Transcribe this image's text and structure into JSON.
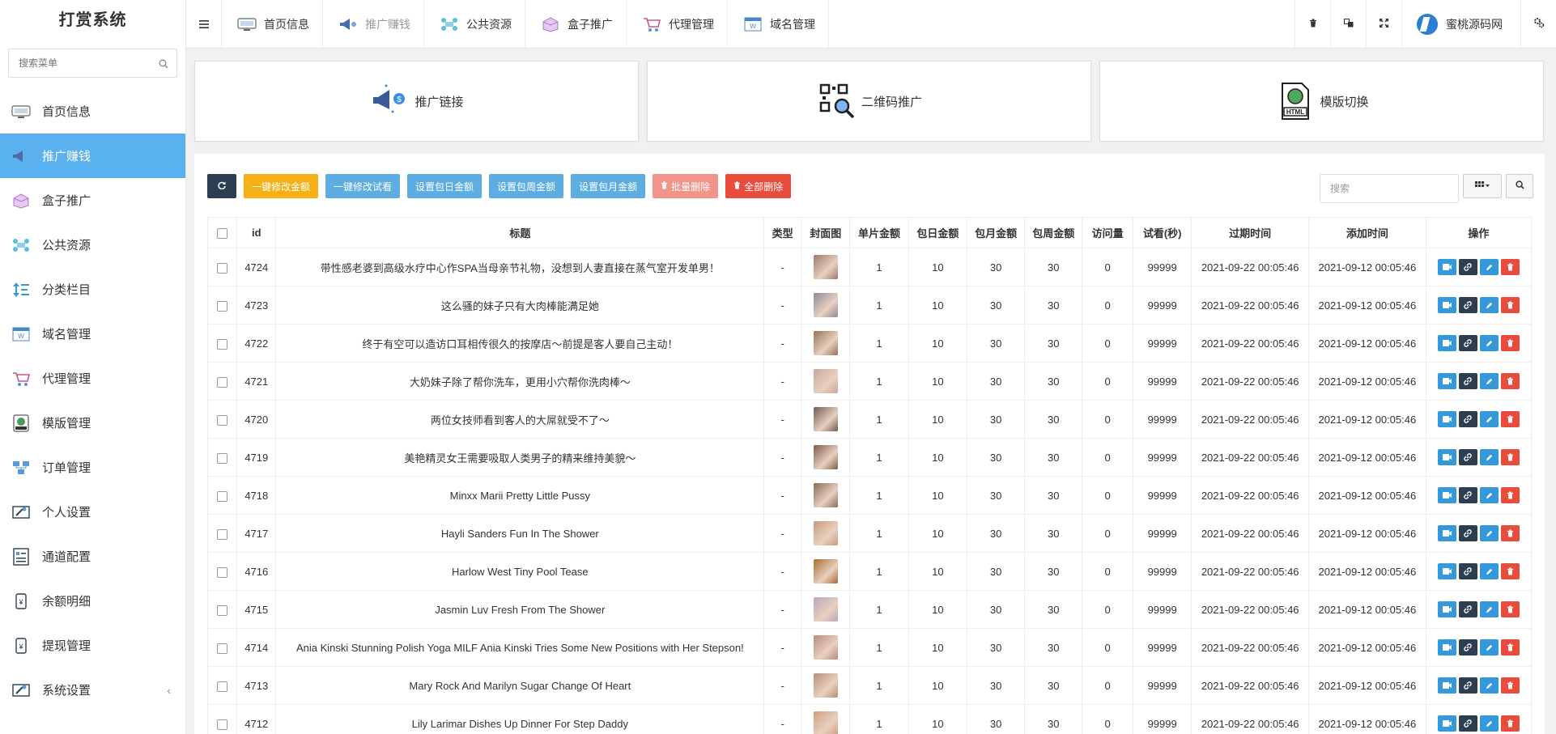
{
  "sidebar": {
    "logo": "打赏系统",
    "search_placeholder": "搜索菜单",
    "items": [
      {
        "label": "首页信息",
        "icon": "monitor-icon"
      },
      {
        "label": "推广赚钱",
        "icon": "megaphone-icon",
        "active": true
      },
      {
        "label": "盒子推广",
        "icon": "box-icon"
      },
      {
        "label": "公共资源",
        "icon": "cloud-network-icon"
      },
      {
        "label": "分类栏目",
        "icon": "sort-icon"
      },
      {
        "label": "域名管理",
        "icon": "domain-window-icon"
      },
      {
        "label": "代理管理",
        "icon": "cart-icon"
      },
      {
        "label": "模版管理",
        "icon": "html-globe-icon"
      },
      {
        "label": "订单管理",
        "icon": "network-order-icon"
      },
      {
        "label": "个人设置",
        "icon": "wrench-card-icon"
      },
      {
        "label": "通道配置",
        "icon": "form-icon"
      },
      {
        "label": "余额明细",
        "icon": "phone-balance-icon"
      },
      {
        "label": "提现管理",
        "icon": "phone-withdraw-icon"
      },
      {
        "label": "系统设置",
        "icon": "settings-card-icon",
        "arrow": "‹"
      }
    ]
  },
  "topbar": {
    "tabs": [
      {
        "label": "首页信息",
        "icon": "monitor-icon"
      },
      {
        "label": "推广赚钱",
        "icon": "megaphone-icon",
        "dim": true
      },
      {
        "label": "公共资源",
        "icon": "cloud-network-icon"
      },
      {
        "label": "盒子推广",
        "icon": "box-icon"
      },
      {
        "label": "代理管理",
        "icon": "cart-icon"
      },
      {
        "label": "域名管理",
        "icon": "domain-window-icon"
      }
    ],
    "user": "蜜桃源码网"
  },
  "cards": [
    {
      "label": "推广链接",
      "icon": "megaphone-coin-icon"
    },
    {
      "label": "二维码推广",
      "icon": "qr-search-icon"
    },
    {
      "label": "模版切换",
      "icon": "html-file-icon"
    }
  ],
  "toolbar": {
    "buttons": [
      "一键修改金额",
      "一键修改试看",
      "设置包日金额",
      "设置包周金额",
      "设置包月金额",
      "批量删除",
      "全部删除"
    ],
    "search_placeholder": "搜索"
  },
  "table": {
    "headers": [
      "id",
      "标题",
      "类型",
      "封面图",
      "单片金额",
      "包日金额",
      "包月金额",
      "包周金额",
      "访问量",
      "试看(秒)",
      "过期时间",
      "添加时间",
      "操作"
    ],
    "rows": [
      {
        "id": "4724",
        "title": "带性感老婆到高级水疗中心作SPA当母亲节礼物，没想到人妻直接在蒸气室开发单男！",
        "type": "-",
        "price": "1",
        "day": "10",
        "month": "30",
        "week": "30",
        "visits": "0",
        "trial": "99999",
        "expire": "2021-09-22 00:05:46",
        "added": "2021-09-12 00:05:46",
        "thumb": "#a0786a"
      },
      {
        "id": "4723",
        "title": "这么骚的妹子只有大肉棒能满足她",
        "type": "-",
        "price": "1",
        "day": "10",
        "month": "30",
        "week": "30",
        "visits": "0",
        "trial": "99999",
        "expire": "2021-09-22 00:05:46",
        "added": "2021-09-12 00:05:46",
        "thumb": "#8f8a98"
      },
      {
        "id": "4722",
        "title": "终于有空可以造访口耳相传很久的按摩店～前提是客人要自己主动！",
        "type": "-",
        "price": "1",
        "day": "10",
        "month": "30",
        "week": "30",
        "visits": "0",
        "trial": "99999",
        "expire": "2021-09-22 00:05:46",
        "added": "2021-09-12 00:05:46",
        "thumb": "#9a7058"
      },
      {
        "id": "4721",
        "title": "大奶妹子除了帮你洗车，更用小穴帮你洗肉棒～",
        "type": "-",
        "price": "1",
        "day": "10",
        "month": "30",
        "week": "30",
        "visits": "0",
        "trial": "99999",
        "expire": "2021-09-22 00:05:46",
        "added": "2021-09-12 00:05:46",
        "thumb": "#c8a89a"
      },
      {
        "id": "4720",
        "title": "两位女技师看到客人的大屌就受不了～",
        "type": "-",
        "price": "1",
        "day": "10",
        "month": "30",
        "week": "30",
        "visits": "0",
        "trial": "99999",
        "expire": "2021-09-22 00:05:46",
        "added": "2021-09-12 00:05:46",
        "thumb": "#6e5a50"
      },
      {
        "id": "4719",
        "title": "美艳精灵女王需要吸取人类男子的精来维持美貌～",
        "type": "-",
        "price": "1",
        "day": "10",
        "month": "30",
        "week": "30",
        "visits": "0",
        "trial": "99999",
        "expire": "2021-09-22 00:05:46",
        "added": "2021-09-12 00:05:46",
        "thumb": "#7e5a48"
      },
      {
        "id": "4718",
        "title": "Minxx Marii Pretty Little Pussy",
        "type": "-",
        "price": "1",
        "day": "10",
        "month": "30",
        "week": "30",
        "visits": "0",
        "trial": "99999",
        "expire": "2021-09-22 00:05:46",
        "added": "2021-09-12 00:05:46",
        "thumb": "#8a6a58"
      },
      {
        "id": "4717",
        "title": "Hayli Sanders Fun In The Shower",
        "type": "-",
        "price": "1",
        "day": "10",
        "month": "30",
        "week": "30",
        "visits": "0",
        "trial": "99999",
        "expire": "2021-09-22 00:05:46",
        "added": "2021-09-12 00:05:46",
        "thumb": "#c99a7a"
      },
      {
        "id": "4716",
        "title": "Harlow West Tiny Pool Tease",
        "type": "-",
        "price": "1",
        "day": "10",
        "month": "30",
        "week": "30",
        "visits": "0",
        "trial": "99999",
        "expire": "2021-09-22 00:05:46",
        "added": "2021-09-12 00:05:46",
        "thumb": "#a86a30"
      },
      {
        "id": "4715",
        "title": "Jasmin Luv Fresh From The Shower",
        "type": "-",
        "price": "1",
        "day": "10",
        "month": "30",
        "week": "30",
        "visits": "0",
        "trial": "99999",
        "expire": "2021-09-22 00:05:46",
        "added": "2021-09-12 00:05:46",
        "thumb": "#b8a8b8"
      },
      {
        "id": "4714",
        "title": "Ania Kinski Stunning Polish Yoga MILF Ania Kinski Tries Some New Positions with Her Stepson!",
        "type": "-",
        "price": "1",
        "day": "10",
        "month": "30",
        "week": "30",
        "visits": "0",
        "trial": "99999",
        "expire": "2021-09-22 00:05:46",
        "added": "2021-09-12 00:05:46",
        "thumb": "#b88a80"
      },
      {
        "id": "4713",
        "title": "Mary Rock And Marilyn Sugar Change Of Heart",
        "type": "-",
        "price": "1",
        "day": "10",
        "month": "30",
        "week": "30",
        "visits": "0",
        "trial": "99999",
        "expire": "2021-09-22 00:05:46",
        "added": "2021-09-12 00:05:46",
        "thumb": "#b89078"
      },
      {
        "id": "4712",
        "title": "Lily Larimar Dishes Up Dinner For Step Daddy",
        "type": "-",
        "price": "1",
        "day": "10",
        "month": "30",
        "week": "30",
        "visits": "0",
        "trial": "99999",
        "expire": "2021-09-22 00:05:46",
        "added": "2021-09-12 00:05:46",
        "thumb": "#d0a080"
      }
    ]
  },
  "colors": {
    "accent": "#5ab1ef",
    "dark": "#2c3e50",
    "warning": "#f5b016",
    "info": "#5dade2",
    "danger": "#e74c3c",
    "danger_light": "#f1948a"
  }
}
